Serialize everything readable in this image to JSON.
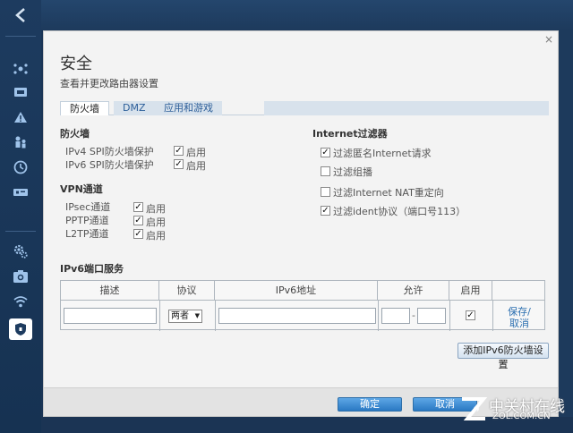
{
  "dialog": {
    "title": "安全",
    "subtitle": "查看并更改路由器设置",
    "close_glyph": "×",
    "tabs": [
      {
        "label": "防火墙",
        "active": true
      },
      {
        "label": "DMZ",
        "active": false
      },
      {
        "label": "应用和游戏",
        "active": false
      }
    ]
  },
  "firewall": {
    "heading": "防火墙",
    "items": [
      {
        "label": "IPv4 SPI防火墙保护",
        "enable_label": "启用",
        "checked": true
      },
      {
        "label": "IPv6 SPI防火墙保护",
        "enable_label": "启用",
        "checked": true
      }
    ]
  },
  "vpn": {
    "heading": "VPN通道",
    "items": [
      {
        "label": "IPsec通道",
        "enable_label": "启用",
        "checked": true
      },
      {
        "label": "PPTP通道",
        "enable_label": "启用",
        "checked": true
      },
      {
        "label": "L2TP通道",
        "enable_label": "启用",
        "checked": true
      }
    ]
  },
  "internet_filter": {
    "heading": "Internet过滤器",
    "items": [
      {
        "label": "过滤匿名Internet请求",
        "checked": true
      },
      {
        "label": "过滤组播",
        "checked": false
      },
      {
        "label": "过滤Internet NAT重定向",
        "checked": false
      },
      {
        "label": "过滤ident协议（端口号113）",
        "checked": true
      }
    ]
  },
  "ipv6_service": {
    "heading": "IPv6端口服务",
    "columns": [
      "描述",
      "协议",
      "IPv6地址",
      "允许",
      "启用",
      ""
    ],
    "row": {
      "description": "",
      "protocol": "两者",
      "address": "",
      "port_from": "",
      "port_sep": "-",
      "port_to": "",
      "enabled": true,
      "save_label": "保存/",
      "cancel_label": "取消"
    },
    "add_button": "添加IPv6防火墙设置"
  },
  "footer": {
    "ok_label": "确定",
    "cancel_label": "取消"
  },
  "watermark": {
    "text": "中关村在线",
    "url": "ZOL.COM.CN"
  },
  "colors": {
    "sidebar_bg": "#1d3b5f",
    "accent_blue": "#2a79c3",
    "link_blue": "#2c6fb0",
    "dialog_bg": "#f3f3f3"
  },
  "icons": {
    "sidebar": [
      "network-map-icon",
      "device-icon",
      "warning-icon",
      "parental-icon",
      "clock-icon",
      "usb-icon",
      "settings-icon",
      "camera-icon",
      "wifi-icon",
      "security-shield-icon"
    ]
  }
}
